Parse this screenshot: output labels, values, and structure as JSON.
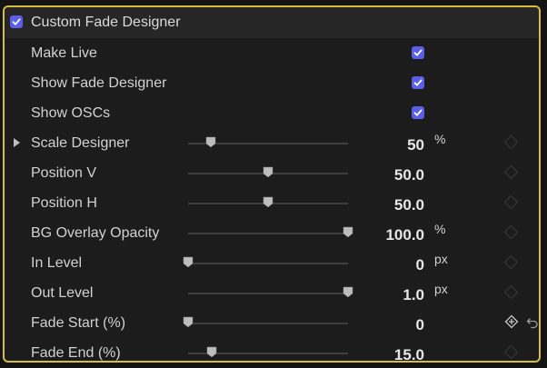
{
  "header": {
    "title": "Custom Fade Designer",
    "checked": true
  },
  "colors": {
    "accent": "#5b5ee6",
    "border": "#d9bd43"
  },
  "checkbox_rows": [
    {
      "label": "Make Live",
      "checked": true
    },
    {
      "label": "Show Fade Designer",
      "checked": true
    },
    {
      "label": "Show OSCs",
      "checked": true
    }
  ],
  "slider_rows": [
    {
      "label": "Scale Designer",
      "value": "50",
      "unit": "%",
      "fraction": 0.14,
      "disclosure": true
    },
    {
      "label": "Position V",
      "value": "50.0",
      "unit": "",
      "fraction": 0.5
    },
    {
      "label": "Position H",
      "value": "50.0",
      "unit": "",
      "fraction": 0.5
    },
    {
      "label": "BG Overlay Opacity",
      "value": "100.0",
      "unit": "%",
      "fraction": 1.0
    },
    {
      "label": "In Level",
      "value": "0",
      "unit": "px",
      "fraction": 0.0
    },
    {
      "label": "Out Level",
      "value": "1.0",
      "unit": "px",
      "fraction": 1.0
    },
    {
      "label": "Fade Start (%)",
      "value": "0",
      "unit": "",
      "fraction": 0.0,
      "add_keyframe": true
    },
    {
      "label": "Fade End (%)",
      "value": "15.0",
      "unit": "",
      "fraction": 0.15
    }
  ],
  "icons": {
    "checkmark": "checkmark-icon",
    "disclosure": "disclosure-triangle-icon",
    "keyframe": "keyframe-diamond-icon",
    "add_keyframe": "add-keyframe-icon",
    "reset": "reset-arrow-icon"
  }
}
